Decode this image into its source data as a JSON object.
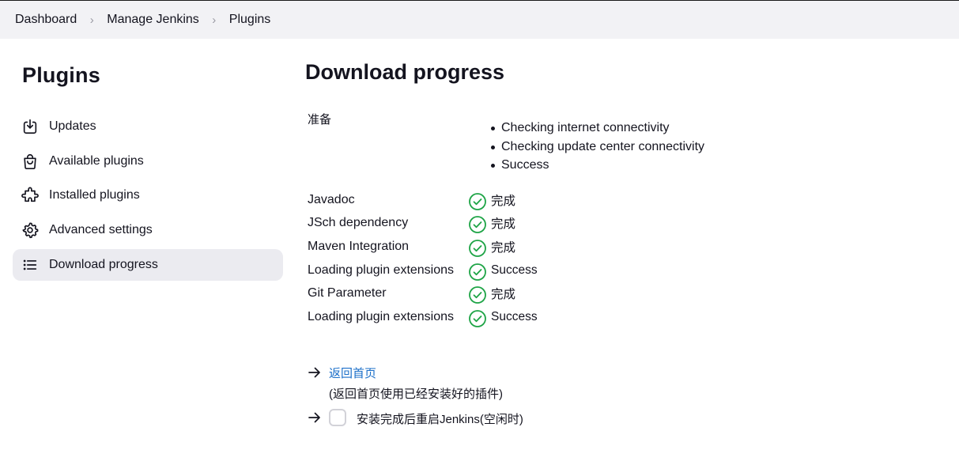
{
  "breadcrumb": {
    "items": [
      "Dashboard",
      "Manage Jenkins",
      "Plugins"
    ]
  },
  "sidebar": {
    "title": "Plugins",
    "items": [
      {
        "label": "Updates",
        "icon": "download-icon"
      },
      {
        "label": "Available plugins",
        "icon": "shopping-bag-icon"
      },
      {
        "label": "Installed plugins",
        "icon": "puzzle-icon"
      },
      {
        "label": "Advanced settings",
        "icon": "gear-icon"
      },
      {
        "label": "Download progress",
        "icon": "list-icon",
        "active": true
      }
    ]
  },
  "main": {
    "title": "Download progress",
    "preparation": {
      "label": "准备",
      "steps": [
        "Checking internet connectivity",
        "Checking update center connectivity",
        "Success"
      ]
    },
    "statuses": [
      {
        "name": "Javadoc",
        "status": "完成"
      },
      {
        "name": "JSch dependency",
        "status": "完成"
      },
      {
        "name": "Maven Integration",
        "status": "完成"
      },
      {
        "name": "Loading plugin extensions",
        "status": "Success"
      },
      {
        "name": "Git Parameter",
        "status": "完成"
      },
      {
        "name": "Loading plugin extensions",
        "status": "Success"
      }
    ],
    "home_link": "返回首页",
    "home_desc": "(返回首页使用已经安装好的插件)",
    "restart_label": "安装完成后重启Jenkins(空闲时)",
    "restart_checked": false
  },
  "colors": {
    "success": "#1ea446",
    "link": "#1b6fc9",
    "active_bg": "#ebebf0",
    "header_bg": "#f2f2f5"
  }
}
